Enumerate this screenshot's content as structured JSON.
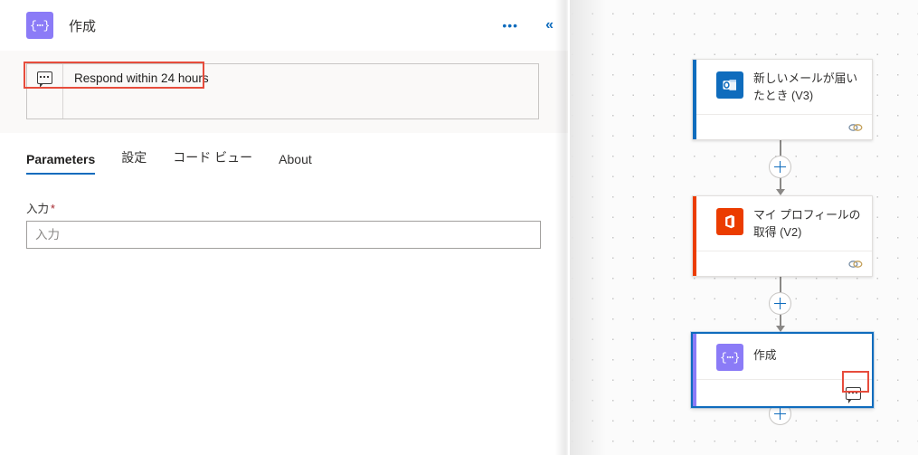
{
  "panel": {
    "header": {
      "icon": "compose-icon",
      "title": "作成",
      "more_label": "•••",
      "collapse_label": "«"
    },
    "comment": {
      "icon": "comment-bubble-icon",
      "text": "Respond within 24 hours",
      "highlighted": true,
      "highlight_color": "#e74c3c"
    },
    "tabs": [
      {
        "label": "Parameters",
        "active": true
      },
      {
        "label": "設定",
        "active": false
      },
      {
        "label": "コード ビュー",
        "active": false
      },
      {
        "label": "About",
        "active": false
      }
    ],
    "field": {
      "label": "入力",
      "required_marker": "*",
      "value": "",
      "placeholder": "入力"
    }
  },
  "canvas": {
    "nodes": [
      {
        "id": "node-1",
        "title": "新しいメールが届いたとき (V3)",
        "icon": "outlook-icon",
        "accent_color": "#0f6cbd",
        "footer_icon": "link-chain-icon",
        "selected": false
      },
      {
        "id": "node-2",
        "title": "マイ プロフィールの取得 (V2)",
        "icon": "office365-icon",
        "accent_color": "#eb3c00",
        "footer_icon": "link-chain-icon",
        "selected": false
      },
      {
        "id": "node-3",
        "title": "作成",
        "icon": "compose-icon",
        "accent_color": "#8b7bf7",
        "footer_icon": "comment-bubble-icon",
        "selected": true,
        "footer_icon_highlighted": true
      }
    ],
    "add_buttons": [
      {
        "label": "+",
        "name": "add-step-button-1"
      },
      {
        "label": "+",
        "name": "add-step-button-2"
      },
      {
        "label": "+",
        "name": "add-step-button-3"
      }
    ]
  },
  "colors": {
    "accent_blue": "#0f6cbd",
    "highlight_red": "#e74c3c",
    "compose_purple": "#8b7bf7",
    "office_orange": "#eb3c00",
    "required_red": "#a4262c"
  }
}
